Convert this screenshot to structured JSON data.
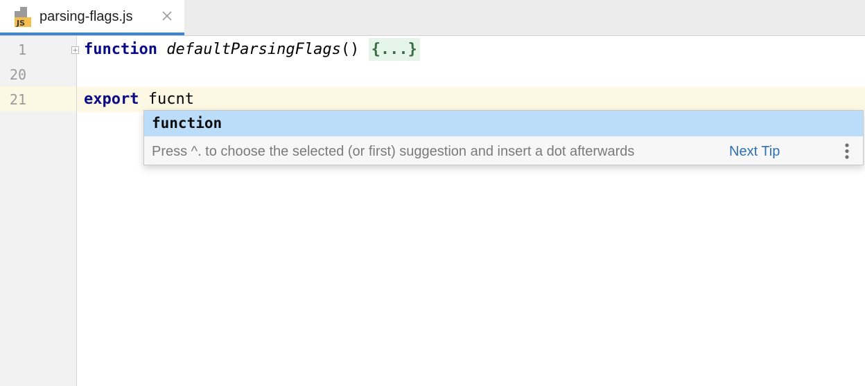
{
  "tab": {
    "file_name": "parsing-flags.js",
    "file_icon_text": "JS",
    "close_glyph": "×",
    "accent": "#3c85d6"
  },
  "gutter": {
    "line_numbers": [
      "1",
      "20",
      "21"
    ]
  },
  "editor": {
    "line1": {
      "keyword": "function",
      "name": "defaultParsingFlags",
      "parens": "()",
      "folded": "{...}"
    },
    "line21": {
      "keyword": "export",
      "typed": "fucnt"
    }
  },
  "completion": {
    "selected_item": "function",
    "tip_text": "Press ^. to choose the selected (or first) suggestion and insert a dot afterwards",
    "next_tip_label": "Next Tip",
    "more_icon": "vertical-ellipsis-icon"
  },
  "colors": {
    "keyword": "#0a0a87",
    "current_line": "#fdf8e3",
    "selection": "#bcddfa",
    "link": "#2e6fb5",
    "folded_bg": "#e5f5e9"
  }
}
